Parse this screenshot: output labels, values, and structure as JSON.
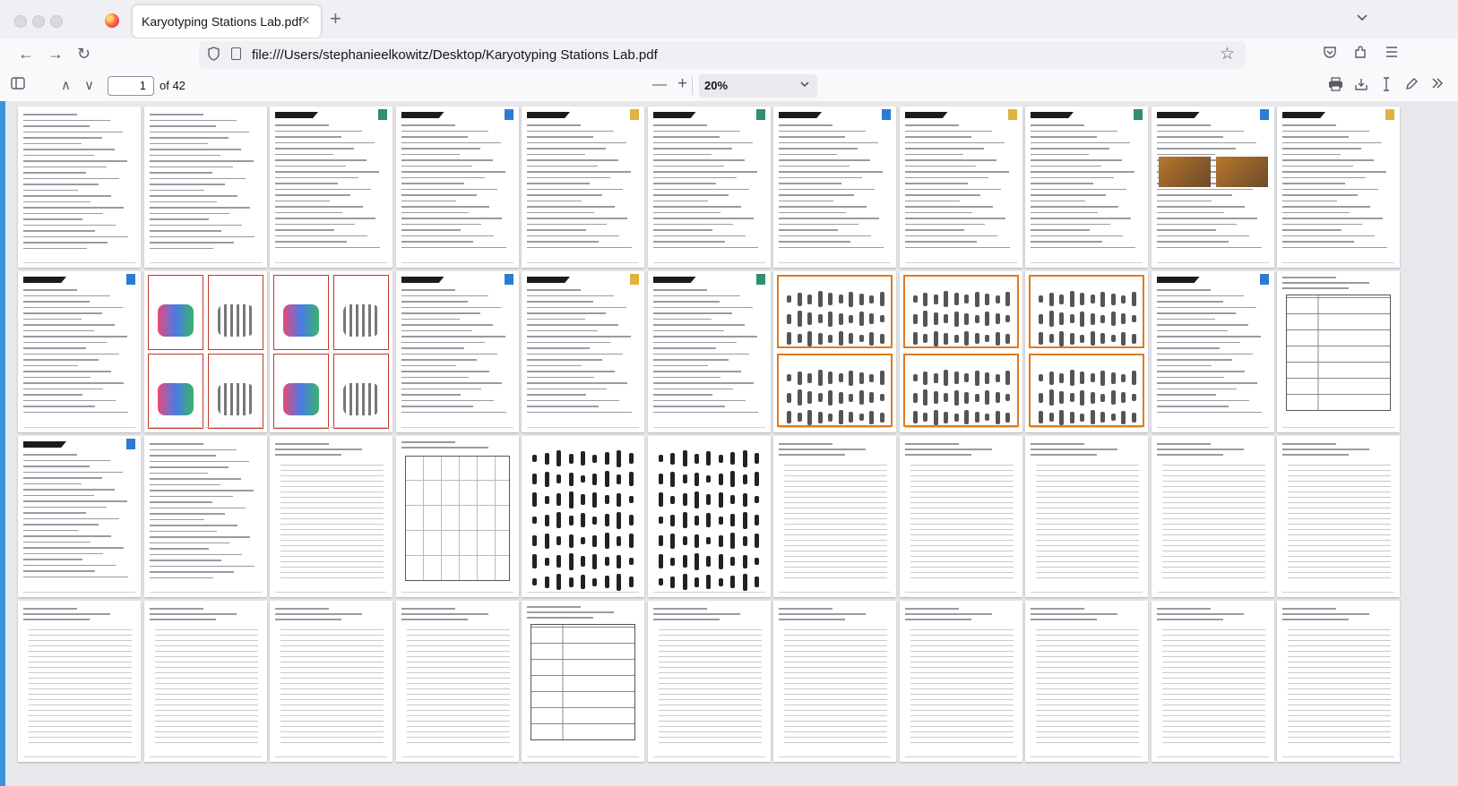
{
  "window": {
    "tab_title": "Karyotyping Stations Lab.pdf",
    "tab_close_glyph": "×",
    "new_tab_glyph": "+",
    "tablist_glyph": "⌄"
  },
  "nav": {
    "url": "file:///Users/stephanieelkowitz/Desktop/Karyotyping Stations Lab.pdf",
    "back_glyph": "←",
    "forward_glyph": "→",
    "reload_glyph": "↻",
    "star_glyph": "☆"
  },
  "pdf_toolbar": {
    "page_number": "1",
    "page_count": "of 42",
    "zoom": "20%",
    "zoom_out_glyph": "—",
    "zoom_in_glyph": "+",
    "up_glyph": "∧",
    "down_glyph": "∨"
  },
  "colors": {
    "accent": "#3b94d9",
    "station_orange": "#e07a1f",
    "question_red": "#c0392b"
  },
  "icons": [
    "firefox-icon",
    "shield-icon",
    "page-icon",
    "bookmark-star-icon",
    "pocket-icon",
    "extensions-icon",
    "menu-icon",
    "sidebar-toggle-icon",
    "print-icon",
    "save-icon",
    "text-cursor-icon",
    "draw-icon",
    "more-tools-icon"
  ]
}
